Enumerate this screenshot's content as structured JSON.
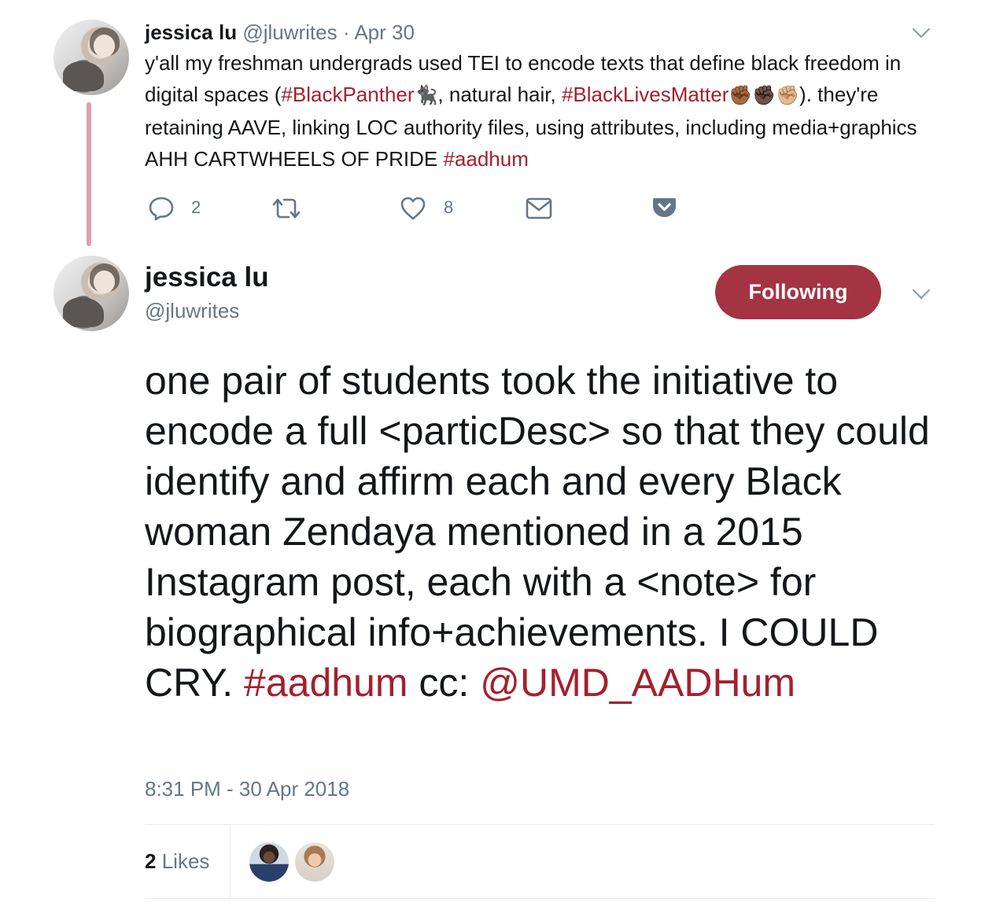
{
  "tweet1": {
    "display_name": "jessica lu",
    "handle": "@jluwrites",
    "separator": "·",
    "date": "Apr 30",
    "text_part1": "y'all my freshman undergrads used TEI to encode texts that define black freedom in digital spaces (",
    "hashtag_black_panther": "#BlackPanther",
    "emoji_panther": "🐈‍⬛",
    "text_part2": ", natural hair, ",
    "hashtag_blm": "#BlackLivesMatter",
    "emoji_fists": "✊🏾✊🏿✊🏼",
    "text_part3": "). they're retaining AAVE, linking LOC authority files, using attributes, including media+graphics AHH CARTWHEELS OF PRIDE ",
    "hashtag_aadhum": "#aadhum",
    "reply_count": "2",
    "like_count": "8"
  },
  "tweet2": {
    "display_name": "jessica lu",
    "handle": "@jluwrites",
    "follow_label": "Following",
    "text": "one pair of students took the initiative to encode a full <particDesc> so that they could identify and affirm each and every Black woman Zendaya mentioned in a 2015 Instagram post, each with a <note> for biographical info+achievements. I COULD CRY. ",
    "hashtag": "#aadhum",
    "cc_text": " cc: ",
    "mention": "@UMD_AADHum",
    "timestamp": "8:31 PM - 30 Apr 2018",
    "likes_count": "2",
    "likes_label": "Likes"
  },
  "colors": {
    "link": "#a4202e",
    "follow_button": "#a43442",
    "thread_line": "#e0a0a9",
    "muted": "#657786"
  },
  "icons": [
    "reply-icon",
    "retweet-icon",
    "like-icon",
    "direct-message-icon",
    "pocket-icon",
    "chevron-down-icon"
  ]
}
